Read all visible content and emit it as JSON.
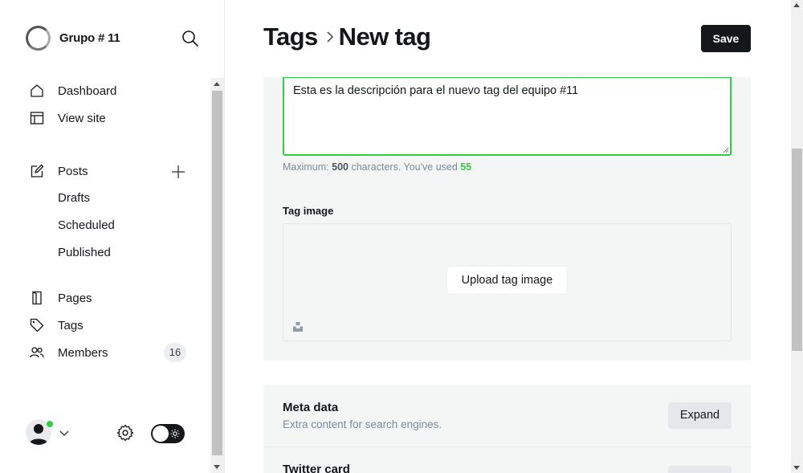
{
  "sidebar": {
    "brand_name": "Grupo # 11",
    "nav": {
      "dashboard": "Dashboard",
      "view_site": "View site",
      "posts": "Posts",
      "drafts": "Drafts",
      "scheduled": "Scheduled",
      "published": "Published",
      "pages": "Pages",
      "tags": "Tags",
      "members": "Members",
      "members_count": "16"
    },
    "accent_online": "#30cf43"
  },
  "header": {
    "breadcrumb_parent": "Tags",
    "page_title": "New tag",
    "save_label": "Save"
  },
  "form": {
    "description_value": "Esta es la descripción para el nuevo tag del equipo #11",
    "hint_prefix": "Maximum: ",
    "hint_max": "500",
    "hint_middle": " characters. You've used ",
    "hint_used": "55",
    "tag_image_label": "Tag image",
    "upload_label": "Upload tag image"
  },
  "sections": {
    "meta_title": "Meta data",
    "meta_desc": "Extra content for search engines.",
    "meta_expand": "Expand",
    "twitter_title": "Twitter card"
  }
}
